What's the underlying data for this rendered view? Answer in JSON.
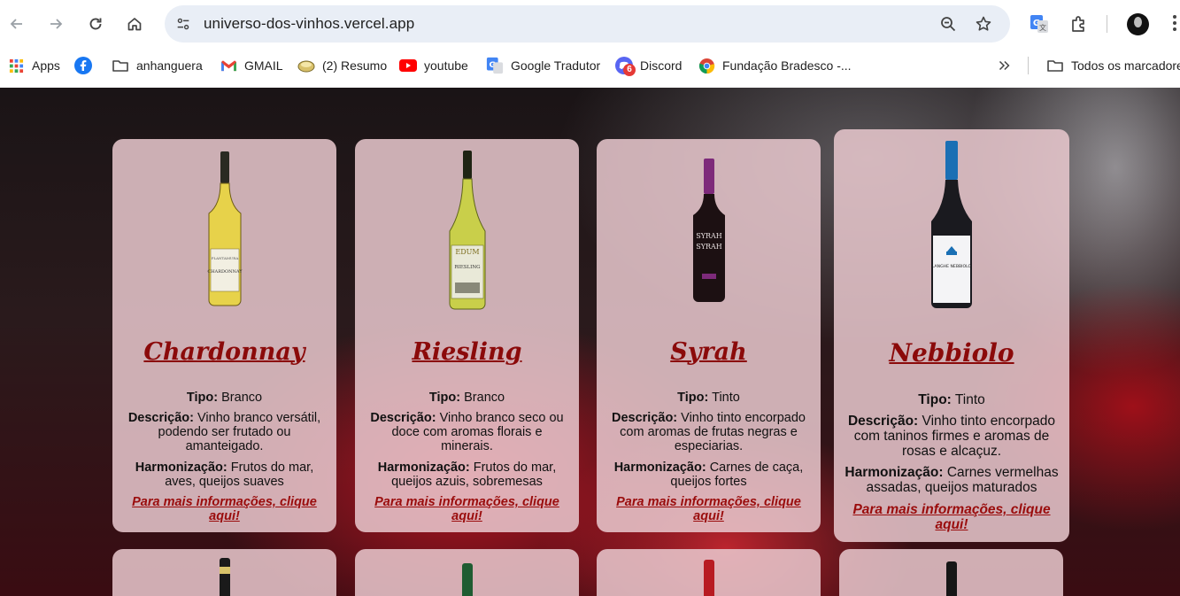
{
  "browser": {
    "url": "universo-dos-vinhos.vercel.app"
  },
  "bookmarks": [
    {
      "label": "Apps",
      "icon": "apps-grid-icon"
    },
    {
      "label": "",
      "icon": "facebook-icon"
    },
    {
      "label": "anhanguera",
      "icon": "folder-icon"
    },
    {
      "label": "GMAIL",
      "icon": "gmail-icon"
    },
    {
      "label": "(2) Resumo",
      "icon": "resumo-icon"
    },
    {
      "label": "youtube",
      "icon": "youtube-icon"
    },
    {
      "label": "Google Tradutor",
      "icon": "google-translate-icon"
    },
    {
      "label": "Discord",
      "icon": "discord-icon",
      "badge": "6"
    },
    {
      "label": "Fundação Bradesco -...",
      "icon": "chrome-icon"
    },
    {
      "label": "Todos os marcadores",
      "icon": "folder-icon"
    }
  ],
  "wines": [
    {
      "name": "Chardonnay",
      "type_label": "Tipo:",
      "type": "Branco",
      "desc_label": "Descrição:",
      "desc": "Vinho branco versátil, podendo ser frutado ou amanteigado.",
      "pair_label": "Harmonização:",
      "pair": "Frutos do mar, aves, queijos suaves",
      "link": "Para mais informações, clique aqui!",
      "bottle_label": "CHARDONNAY",
      "bottle_brand": "PLANTAMURA",
      "glass_color": "#3b3a1c",
      "wine_color": "#e7d24a",
      "cap_color": "#2a2a22"
    },
    {
      "name": "Riesling",
      "type_label": "Tipo:",
      "type": "Branco",
      "desc_label": "Descrição:",
      "desc": "Vinho branco seco ou doce com aromas florais e minerais.",
      "pair_label": "Harmonização:",
      "pair": "Frutos do mar, queijos azuis, sobremesas",
      "link": "Para mais informações, clique aqui!",
      "bottle_label": "RIESLING",
      "bottle_brand": "EDUM",
      "glass_color": "#7d8a2a",
      "wine_color": "#c9cf4a",
      "cap_color": "#1e2413"
    },
    {
      "name": "Syrah",
      "type_label": "Tipo:",
      "type": "Tinto",
      "desc_label": "Descrição:",
      "desc": "Vinho tinto encorpado com aromas de frutas negras e especiarias.",
      "pair_label": "Harmonização:",
      "pair": "Carnes de caça, queijos fortes",
      "link": "Para mais informações, clique aqui!",
      "bottle_label": "SYRAH SYRAH",
      "bottle_brand": "",
      "glass_color": "#1c1012",
      "wine_color": "#1c1012",
      "cap_color": "#7d2a7a"
    },
    {
      "name": "Nebbiolo",
      "type_label": "Tipo:",
      "type": "Tinto",
      "desc_label": "Descrição:",
      "desc": "Vinho tinto encorpado com taninos firmes e aromas de rosas e alcaçuz.",
      "pair_label": "Harmonização:",
      "pair": "Carnes vermelhas assadas, queijos maturados",
      "link": "Para mais informações, clique aqui!",
      "bottle_label": "LANGHE NEBBIOLO",
      "bottle_brand": "",
      "glass_color": "#1a1a1f",
      "wine_color": "#1a1a1f",
      "cap_color": "#1a6fb4"
    }
  ],
  "row2_caps": [
    "#1a1a1a",
    "#1f5c32",
    "#b81b22",
    "#161616"
  ]
}
